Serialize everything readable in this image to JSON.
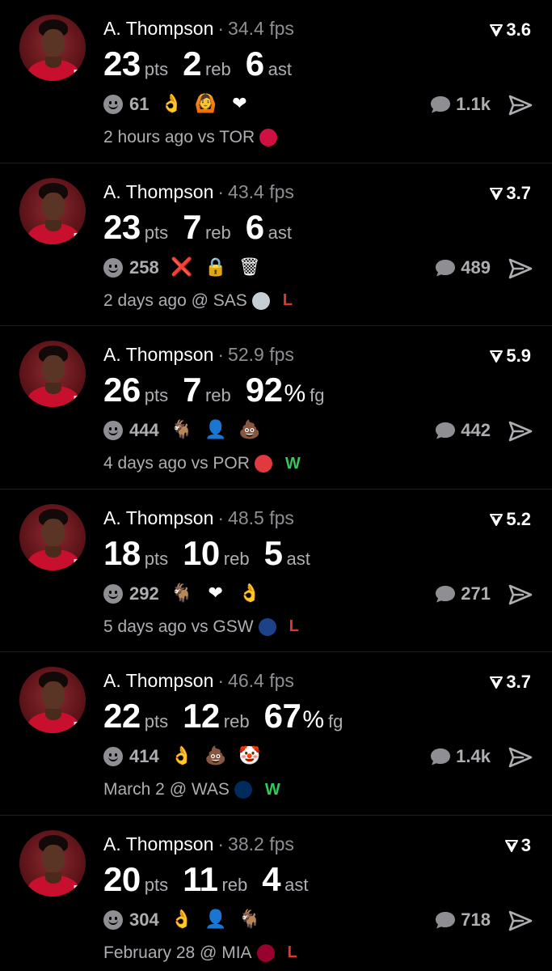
{
  "posts": [
    {
      "name": "A. Thompson",
      "fps": "34.4 fps",
      "rating": "3.6",
      "stats": [
        {
          "num": "23",
          "label": "pts"
        },
        {
          "num": "2",
          "label": "reb"
        },
        {
          "num": "6",
          "label": "ast"
        }
      ],
      "react_count": "61",
      "reactions": [
        "👌",
        "🙆",
        "❤"
      ],
      "comments": "1.1k",
      "time": "2 hours ago vs TOR",
      "team_icon": "raptors-logo-icon",
      "team_color": "#ce1141",
      "result": ""
    },
    {
      "name": "A. Thompson",
      "fps": "43.4 fps",
      "rating": "3.7",
      "stats": [
        {
          "num": "23",
          "label": "pts"
        },
        {
          "num": "7",
          "label": "reb"
        },
        {
          "num": "6",
          "label": "ast"
        }
      ],
      "react_count": "258",
      "reactions": [
        "❌",
        "🔒",
        "🗑"
      ],
      "comments": "489",
      "time": "2 days ago @ SAS",
      "team_icon": "spurs-logo-icon",
      "team_color": "#c4ced4",
      "result": "L"
    },
    {
      "name": "A. Thompson",
      "fps": "52.9 fps",
      "rating": "5.9",
      "stats": [
        {
          "num": "26",
          "label": "pts"
        },
        {
          "num": "7",
          "label": "reb"
        },
        {
          "num": "92",
          "pct": "%",
          "label": "fg"
        }
      ],
      "react_count": "444",
      "reactions": [
        "🐐",
        "👤",
        "💩"
      ],
      "comments": "442",
      "time": "4 days ago vs POR",
      "team_icon": "blazers-logo-icon",
      "team_color": "#e03a3e",
      "result": "W"
    },
    {
      "name": "A. Thompson",
      "fps": "48.5 fps",
      "rating": "5.2",
      "stats": [
        {
          "num": "18",
          "label": "pts"
        },
        {
          "num": "10",
          "label": "reb"
        },
        {
          "num": "5",
          "label": "ast"
        }
      ],
      "react_count": "292",
      "reactions": [
        "🐐",
        "❤",
        "👌"
      ],
      "comments": "271",
      "time": "5 days ago vs GSW",
      "team_icon": "warriors-logo-icon",
      "team_color": "#1d428a",
      "result": "L"
    },
    {
      "name": "A. Thompson",
      "fps": "46.4 fps",
      "rating": "3.7",
      "stats": [
        {
          "num": "22",
          "label": "pts"
        },
        {
          "num": "12",
          "label": "reb"
        },
        {
          "num": "67",
          "pct": "%",
          "label": "fg"
        }
      ],
      "react_count": "414",
      "reactions": [
        "👌",
        "💩",
        "🤡"
      ],
      "comments": "1.4k",
      "time": "March 2 @ WAS",
      "team_icon": "wizards-logo-icon",
      "team_color": "#002b5c",
      "result": "W"
    },
    {
      "name": "A. Thompson",
      "fps": "38.2 fps",
      "rating": "3",
      "stats": [
        {
          "num": "20",
          "label": "pts"
        },
        {
          "num": "11",
          "label": "reb"
        },
        {
          "num": "4",
          "label": "ast"
        }
      ],
      "react_count": "304",
      "reactions": [
        "👌",
        "👤",
        "🐐"
      ],
      "comments": "718",
      "time": "February 28 @ MIA",
      "team_icon": "heat-logo-icon",
      "team_color": "#98002e",
      "result": "L"
    }
  ],
  "name_sep": "·"
}
